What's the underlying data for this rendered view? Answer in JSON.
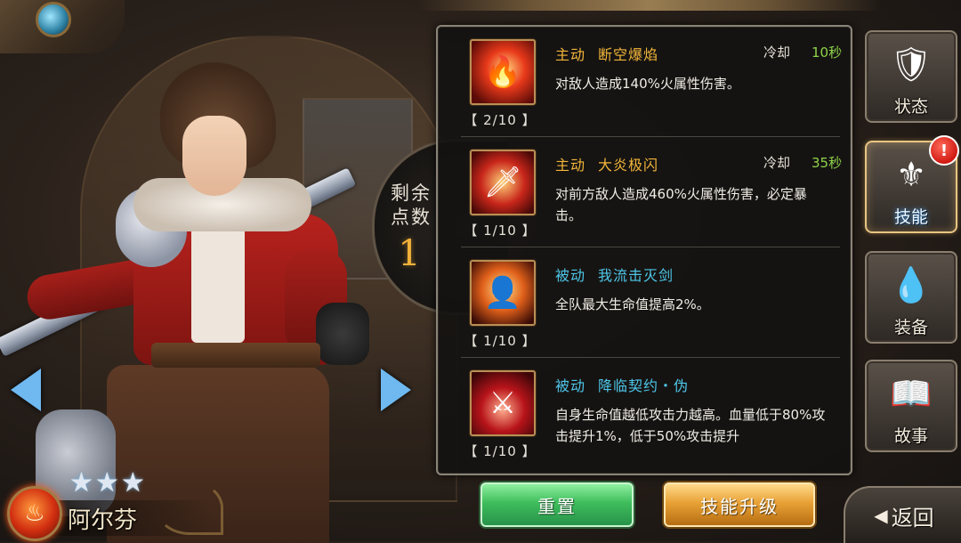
{
  "hero": {
    "name": "阿尔芬",
    "stars": 3,
    "element_icon": "fire-icon"
  },
  "points": {
    "label_line1": "剩余",
    "label_line2": "点数",
    "value": "1"
  },
  "skills": [
    {
      "type": "主动",
      "name": "断空爆焰",
      "cooldown_label": "冷却",
      "cooldown": "10秒",
      "description": "对敌人造成140%火属性伤害。",
      "level": "【 2/10 】",
      "icon": "flame-slash-icon"
    },
    {
      "type": "主动",
      "name": "大炎极闪",
      "cooldown_label": "冷却",
      "cooldown": "35秒",
      "description": "对前方敌人造成460%火属性伤害，必定暴击。",
      "level": "【 1/10 】",
      "icon": "flame-sword-icon"
    },
    {
      "type": "被动",
      "name": "我流击灭剑",
      "description": "全队最大生命值提高2%。",
      "level": "【 1/10 】",
      "icon": "burning-figure-icon"
    },
    {
      "type": "被动",
      "name": "降临契约・伪",
      "description": "自身生命值越低攻击力越高。血量低于80%攻击提升1%，低于50%攻击提升",
      "level": "【 1/10 】",
      "icon": "demon-sword-icon"
    }
  ],
  "buttons": {
    "reset": "重置",
    "upgrade": "技能升级",
    "back": "返回"
  },
  "menu": [
    {
      "label": "状态",
      "icon": "character-status-icon"
    },
    {
      "label": "技能",
      "icon": "golden-crest-icon",
      "alert": "!"
    },
    {
      "label": "装备",
      "icon": "crystal-icon"
    },
    {
      "label": "故事",
      "icon": "book-icon"
    }
  ],
  "colors": {
    "active_skill": "#f2b53a",
    "passive_skill": "#4ec6e8",
    "cooldown_value": "#8fd34a",
    "points_value": "#f0b13a",
    "reset_button": "#3fbd5c",
    "upgrade_button": "#e8a236"
  }
}
